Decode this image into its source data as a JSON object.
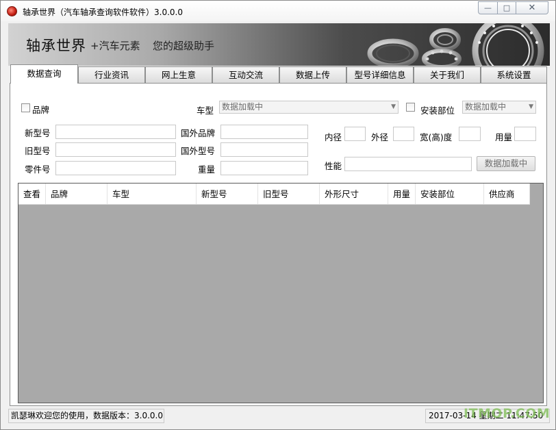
{
  "window": {
    "title": "轴承世界（汽车轴承查询软件软件）3.0.0.0",
    "minimize_glyph": "—",
    "maximize_glyph": "□",
    "close_glyph": "✕"
  },
  "banner": {
    "title": "轴承世界",
    "subtitle": "+汽车元素",
    "slogan": "您的超级助手"
  },
  "tabs": [
    {
      "label": "数据查询",
      "active": true
    },
    {
      "label": "行业资讯",
      "active": false
    },
    {
      "label": "网上生意",
      "active": false
    },
    {
      "label": "互动交流",
      "active": false
    },
    {
      "label": "数据上传",
      "active": false
    },
    {
      "label": "型号详细信息",
      "active": false
    },
    {
      "label": "关于我们",
      "active": false
    },
    {
      "label": "系统设置",
      "active": false
    }
  ],
  "search": {
    "brand_checkbox_label": "品牌",
    "car_model_label": "车型",
    "car_model_value": "数据加载中",
    "install_position_label": "安装部位",
    "install_position_value": "数据加载中",
    "new_model_label": "新型号",
    "old_model_label": "旧型号",
    "part_no_label": "零件号",
    "foreign_brand_label": "国外品牌",
    "foreign_model_label": "国外型号",
    "weight_label": "重量",
    "inner_diameter_label": "内径",
    "outer_diameter_label": "外径",
    "width_height_label": "宽(高)度",
    "usage_label": "用量",
    "performance_label": "性能",
    "loading_button_label": "数据加载中"
  },
  "grid": {
    "columns": [
      "查看",
      "品牌",
      "车型",
      "新型号",
      "旧型号",
      "外形尺寸",
      "用量",
      "安装部位",
      "供应商"
    ]
  },
  "status": {
    "left": "凯瑟琳欢迎您的使用，数据版本：3.0.0.0",
    "right": "2017-03-14 星期二 11:47:50"
  },
  "watermark": "ITMOP.COM",
  "colors": {
    "grid_background": "#a9a9a9",
    "banner_dark": "#2b2b2b",
    "banner_light": "#d2d2d2",
    "watermark_green": "#82be5a"
  },
  "icons": {
    "app": "app-logo-icon",
    "dropdown": "chevron-down-icon"
  }
}
